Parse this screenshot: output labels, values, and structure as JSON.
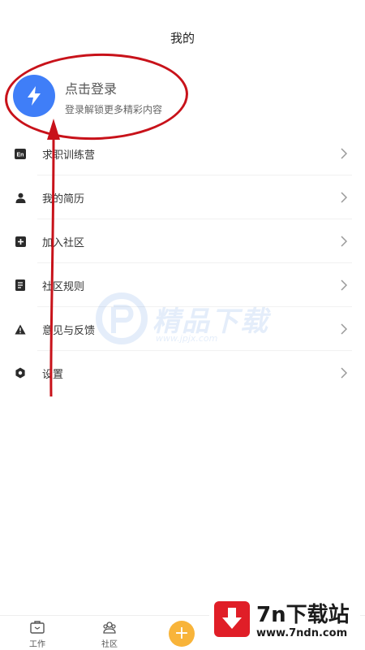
{
  "header": {
    "title": "我的"
  },
  "profile": {
    "login_title": "点击登录",
    "login_subtitle": "登录解锁更多精彩内容",
    "avatar_icon": "lightning-icon",
    "avatar_color": "#3f7ef8"
  },
  "menu": {
    "items": [
      {
        "label": "求职训练营",
        "icon": "en-badge-icon"
      },
      {
        "label": "我的简历",
        "icon": "person-icon"
      },
      {
        "label": "加入社区",
        "icon": "plus-square-icon"
      },
      {
        "label": "社区规则",
        "icon": "document-icon"
      },
      {
        "label": "意见与反馈",
        "icon": "warning-icon"
      },
      {
        "label": "设置",
        "icon": "hexagon-settings-icon"
      }
    ]
  },
  "watermark": {
    "text": "精品下载",
    "url": "www.jpjx.com"
  },
  "tabbar": {
    "tabs": [
      {
        "label": "工作",
        "icon": "briefcase-icon"
      },
      {
        "label": "社区",
        "icon": "community-icon"
      }
    ],
    "add_symbol": "+",
    "add_color": "#f8b43a"
  },
  "brand": {
    "name": "7n下载站",
    "url": "www.7ndn.com",
    "color": "#e01e27"
  },
  "annotation": {
    "color": "#c8121a"
  }
}
